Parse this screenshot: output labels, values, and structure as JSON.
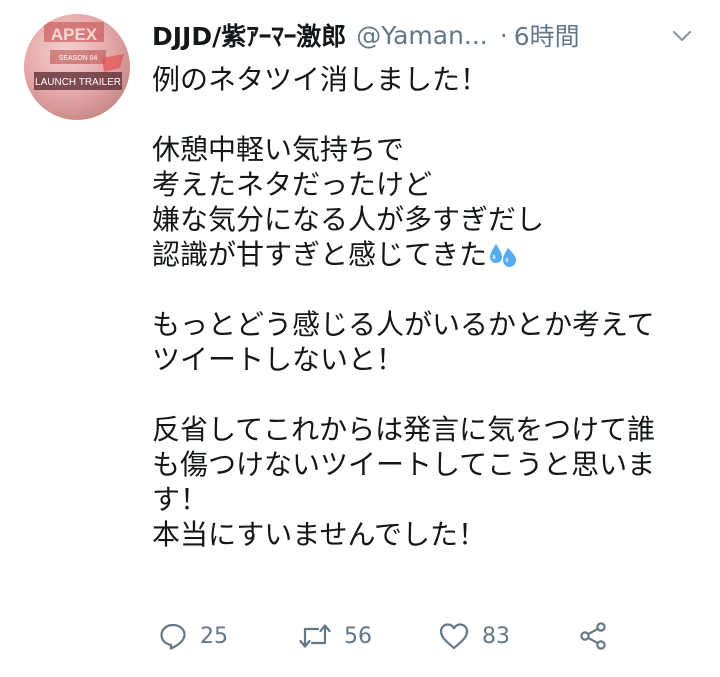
{
  "author": {
    "display_name": "DJJD/紫ｱｰﾏｰ激郎",
    "handle": "@Yaman...",
    "separator": "·",
    "time": "6時間",
    "avatar_text": [
      "APEX",
      "SEASON 04",
      "LAUNCH TRAILER"
    ]
  },
  "tweet": {
    "lines": [
      "例のネタツイ消しました！",
      "",
      "休憩中軽い気持ちで",
      "考えたネタだったけど",
      "嫌な気分になる人が多すぎだし",
      "認識が甘すぎと感じてきた",
      "",
      "もっとどう感じる人がいるかとか考えて",
      "ツイートしないと！",
      "",
      "反省してこれからは発言に気をつけて誰",
      "も傷つけないツイートしてこうと思いま",
      "す！",
      "本当にすいませんでした！"
    ]
  },
  "actions": {
    "reply_count": "25",
    "retweet_count": "56",
    "like_count": "83"
  },
  "icons": {
    "menu": "chevron-down-icon",
    "reply": "reply-icon",
    "retweet": "retweet-icon",
    "like": "heart-icon",
    "share": "share-icon",
    "emoji": "sweat-droplets-emoji"
  },
  "colors": {
    "text": "#14171a",
    "secondary": "#657786",
    "emoji_blue": "#55acee"
  }
}
